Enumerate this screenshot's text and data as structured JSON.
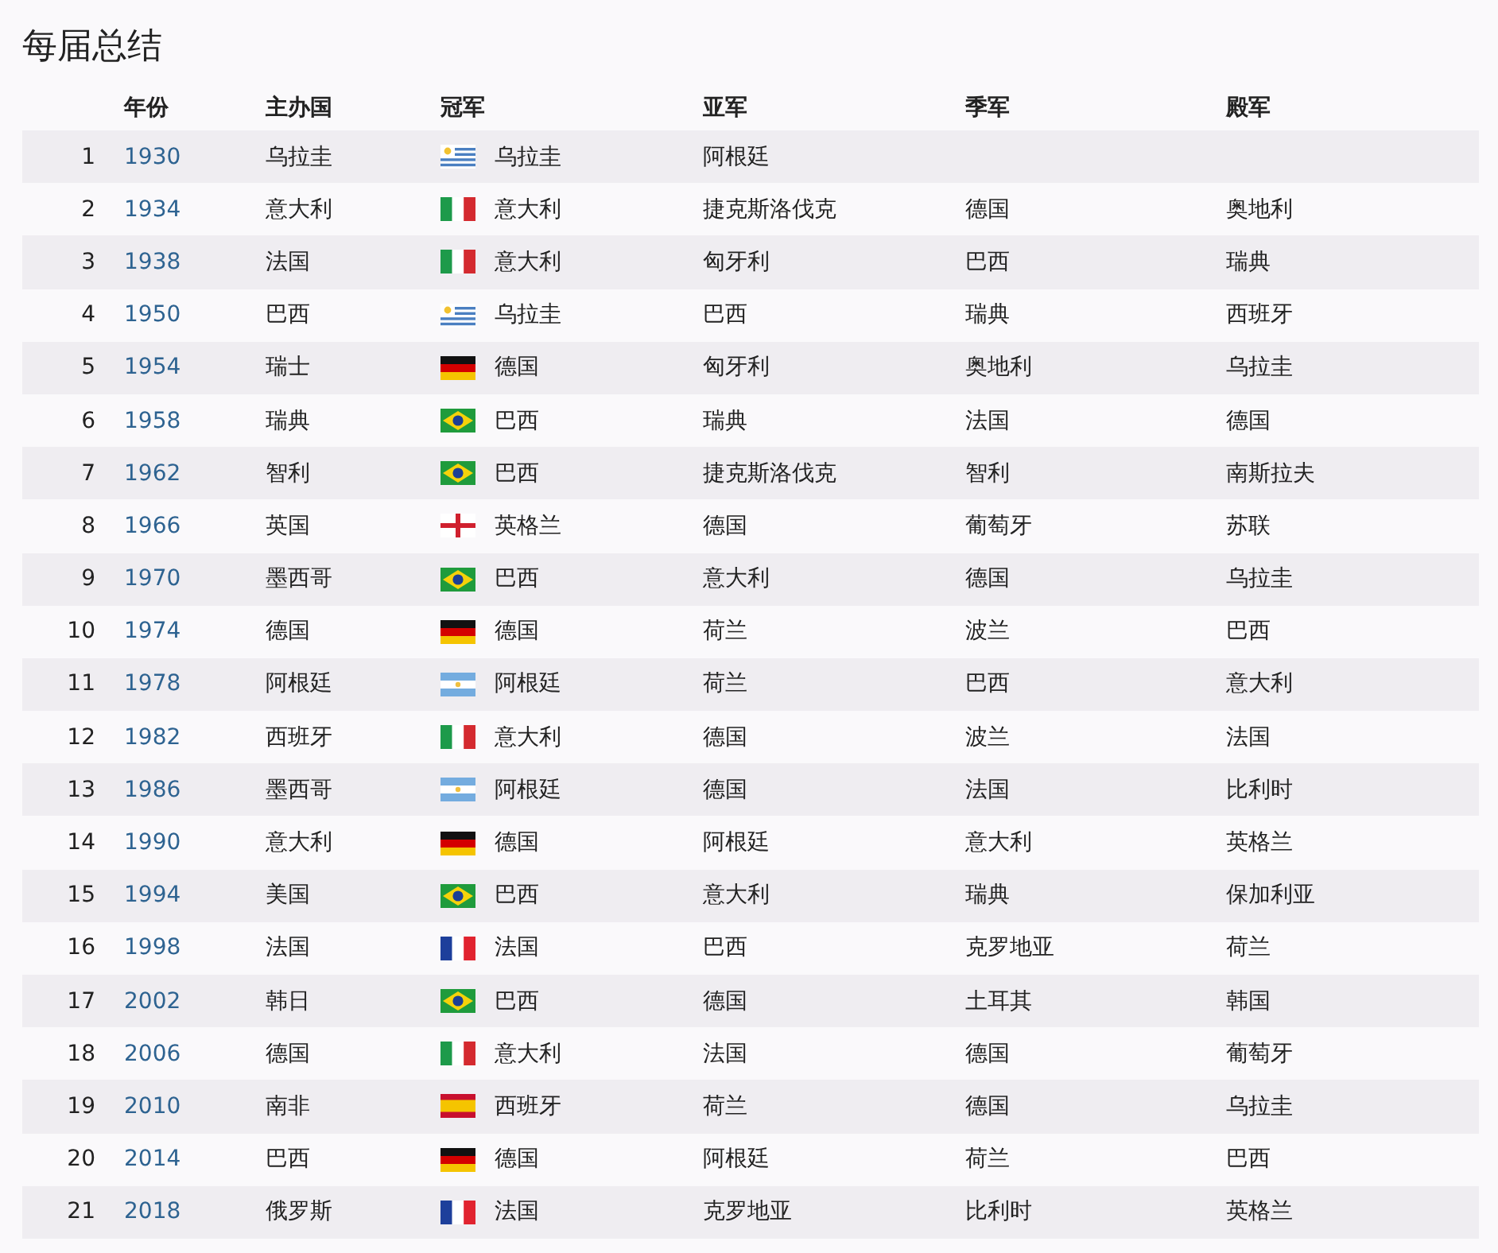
{
  "title": "每届总结",
  "table": {
    "columns": [
      "年份",
      "主办国",
      "冠军",
      "亚军",
      "季军",
      "殿军"
    ],
    "rows": [
      {
        "no": "1",
        "year": "1930",
        "host": "乌拉圭",
        "champion": "乌拉圭",
        "kind": "uruguay",
        "second": "阿根廷"
      },
      {
        "no": "2",
        "year": "1934",
        "host": "意大利",
        "champion": "意大利",
        "kind": "italy",
        "second": "捷克斯洛伐克",
        "third": "德国",
        "fourth": "奥地利"
      },
      {
        "no": "3",
        "year": "1938",
        "host": "法国",
        "champion": "意大利",
        "kind": "italy",
        "second": "匈牙利",
        "third": "巴西",
        "fourth": "瑞典"
      },
      {
        "no": "4",
        "year": "1950",
        "host": "巴西",
        "champion": "乌拉圭",
        "kind": "uruguay",
        "second": "巴西",
        "third": "瑞典",
        "fourth": "西班牙"
      },
      {
        "no": "5",
        "year": "1954",
        "host": "瑞士",
        "champion": "德国",
        "kind": "germany",
        "second": "匈牙利",
        "third": "奥地利",
        "fourth": "乌拉圭"
      },
      {
        "no": "6",
        "year": "1958",
        "host": "瑞典",
        "champion": "巴西",
        "kind": "brazil",
        "second": "瑞典",
        "third": "法国",
        "fourth": "德国"
      },
      {
        "no": "7",
        "year": "1962",
        "host": "智利",
        "champion": "巴西",
        "kind": "brazil",
        "second": "捷克斯洛伐克",
        "third": "智利",
        "fourth": "南斯拉夫"
      },
      {
        "no": "8",
        "year": "1966",
        "host": "英国",
        "champion": "英格兰",
        "kind": "england",
        "second": "德国",
        "third": "葡萄牙",
        "fourth": "苏联"
      },
      {
        "no": "9",
        "year": "1970",
        "host": "墨西哥",
        "champion": "巴西",
        "kind": "brazil",
        "second": "意大利",
        "third": "德国",
        "fourth": "乌拉圭"
      },
      {
        "no": "10",
        "year": "1974",
        "host": "德国",
        "champion": "德国",
        "kind": "germany",
        "second": "荷兰",
        "third": "波兰",
        "fourth": "巴西"
      },
      {
        "no": "11",
        "year": "1978",
        "host": "阿根廷",
        "champion": "阿根廷",
        "kind": "argentina",
        "second": "荷兰",
        "third": "巴西",
        "fourth": "意大利"
      },
      {
        "no": "12",
        "year": "1982",
        "host": "西班牙",
        "champion": "意大利",
        "kind": "italy",
        "second": "德国",
        "third": "波兰",
        "fourth": "法国"
      },
      {
        "no": "13",
        "year": "1986",
        "host": "墨西哥",
        "champion": "阿根廷",
        "kind": "argentina",
        "second": "德国",
        "third": "法国",
        "fourth": "比利时"
      },
      {
        "no": "14",
        "year": "1990",
        "host": "意大利",
        "champion": "德国",
        "kind": "germany",
        "second": "阿根廷",
        "third": "意大利",
        "fourth": "英格兰"
      },
      {
        "no": "15",
        "year": "1994",
        "host": "美国",
        "champion": "巴西",
        "kind": "brazil",
        "second": "意大利",
        "third": "瑞典",
        "fourth": "保加利亚"
      },
      {
        "no": "16",
        "year": "1998",
        "host": "法国",
        "champion": "法国",
        "kind": "france",
        "second": "巴西",
        "third": "克罗地亚",
        "fourth": "荷兰"
      },
      {
        "no": "17",
        "year": "2002",
        "host": "韩日",
        "champion": "巴西",
        "kind": "brazil",
        "second": "德国",
        "third": "土耳其",
        "fourth": "韩国"
      },
      {
        "no": "18",
        "year": "2006",
        "host": "德国",
        "champion": "意大利",
        "kind": "italy",
        "second": "法国",
        "third": "德国",
        "fourth": "葡萄牙"
      },
      {
        "no": "19",
        "year": "2010",
        "host": "南非",
        "champion": "西班牙",
        "kind": "spain",
        "second": "荷兰",
        "third": "德国",
        "fourth": "乌拉圭"
      },
      {
        "no": "20",
        "year": "2014",
        "host": "巴西",
        "champion": "德国",
        "kind": "germany",
        "second": "阿根廷",
        "third": "荷兰",
        "fourth": "巴西"
      },
      {
        "no": "21",
        "year": "2018",
        "host": "俄罗斯",
        "champion": "法国",
        "kind": "france",
        "second": "克罗地亚",
        "third": "比利时",
        "fourth": "英格兰"
      }
    ]
  }
}
